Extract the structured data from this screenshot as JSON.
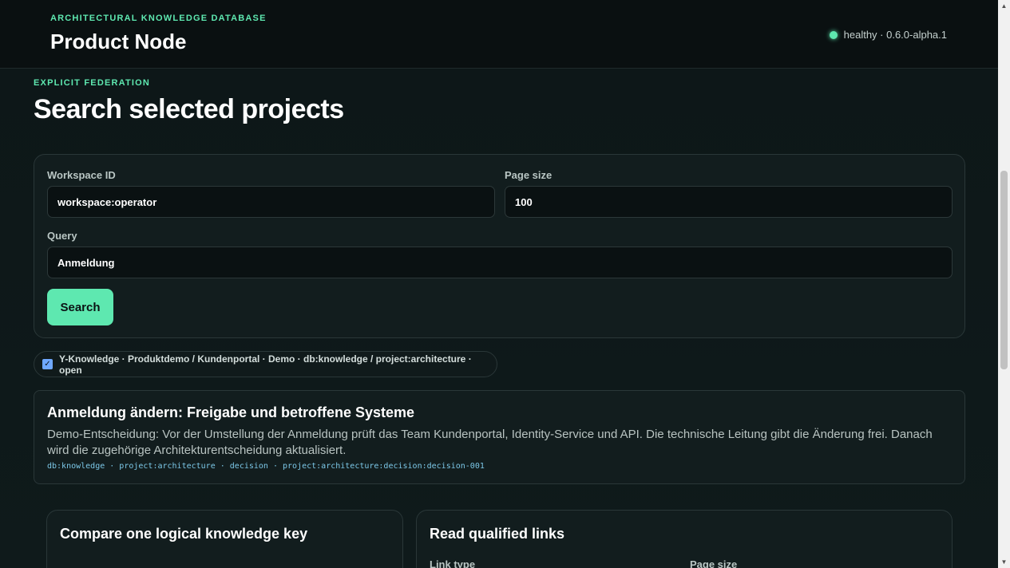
{
  "header": {
    "eyebrow": "ARCHITECTURAL KNOWLEDGE DATABASE",
    "title": "Product Node",
    "status_text": "healthy · 0.6.0-alpha.1"
  },
  "section": {
    "eyebrow": "EXPLICIT FEDERATION",
    "title": "Search selected projects"
  },
  "form": {
    "workspace_label": "Workspace ID",
    "workspace_value": "workspace:operator",
    "page_size_label": "Page size",
    "page_size_value": "100",
    "query_label": "Query",
    "query_value": "Anmeldung",
    "search_button": "Search"
  },
  "project_selector": {
    "checked": true,
    "label": "Y-Knowledge · Produktdemo / Kundenportal · Demo · db:knowledge / project:architecture · open"
  },
  "results": [
    {
      "title": "Anmeldung ändern: Freigabe und betroffene Systeme",
      "description": "Demo-Entscheidung: Vor der Umstellung der Anmeldung prüft das Team Kundenportal, Identity-Service und API. Die technische Leitung gibt die Änderung frei. Danach wird die zugehörige Architekturentscheidung aktualisiert.",
      "meta": "db:knowledge · project:architecture · decision · project:architecture:decision:decision-001"
    }
  ],
  "compare_card": {
    "title": "Compare one logical knowledge key"
  },
  "links_card": {
    "title": "Read qualified links",
    "link_type_label": "Link type",
    "page_size_label": "Page size"
  },
  "colors": {
    "accent": "#5ee8b0",
    "background": "#0b1314",
    "card": "#121d1e",
    "meta": "#7cc8e8"
  }
}
